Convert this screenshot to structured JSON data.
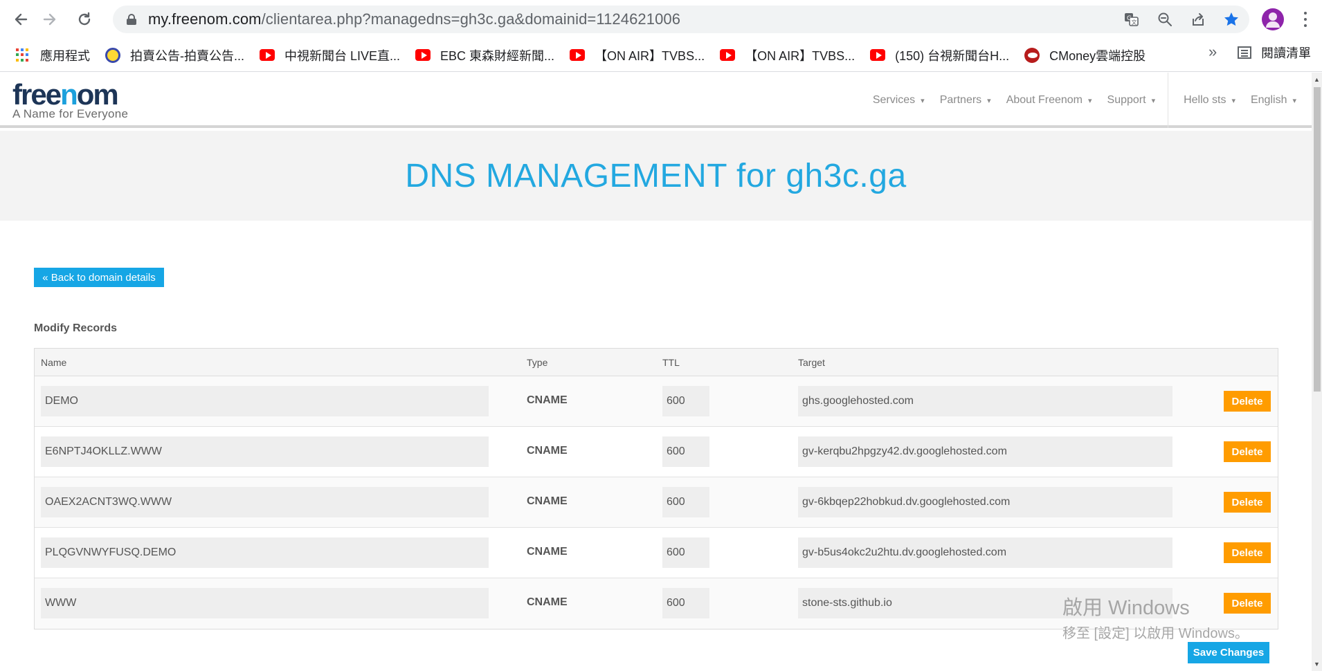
{
  "browser": {
    "url_host": "my.freenom.com",
    "url_rest": "/clientarea.php?managedns=gh3c.ga&domainid=1124621006",
    "bookmarks": [
      {
        "label": "應用程式",
        "icon": "apps-grid-icon"
      },
      {
        "label": "拍賣公告-拍賣公告...",
        "icon": "auction-icon"
      },
      {
        "label": "中視新聞台 LIVE直...",
        "icon": "youtube-icon"
      },
      {
        "label": "EBC 東森財經新聞...",
        "icon": "youtube-icon"
      },
      {
        "label": "【ON AIR】TVBS...",
        "icon": "youtube-icon"
      },
      {
        "label": "【ON AIR】TVBS...",
        "icon": "youtube-icon"
      },
      {
        "label": "(150) 台視新聞台H...",
        "icon": "youtube-icon"
      },
      {
        "label": "CMoney雲端控股",
        "icon": "cmoney-icon"
      }
    ],
    "overflow_label": "»",
    "reading_list_label": "閱讀清單"
  },
  "site": {
    "logo_dark_1": "free",
    "logo_blue": "n",
    "logo_dark_2": "om",
    "tagline": "A Name for Everyone",
    "nav": [
      "Services",
      "Partners",
      "About Freenom",
      "Support"
    ],
    "user_menu": "Hello sts",
    "language": "English"
  },
  "page": {
    "title": "DNS MANAGEMENT for gh3c.ga",
    "back_button": "« Back to domain details",
    "section_heading": "Modify Records",
    "columns": {
      "name": "Name",
      "type": "Type",
      "ttl": "TTL",
      "target": "Target"
    },
    "records": [
      {
        "name": "DEMO",
        "type": "CNAME",
        "ttl": "600",
        "target": "ghs.googlehosted.com",
        "action": "Delete"
      },
      {
        "name": "E6NPTJ4OKLLZ.WWW",
        "type": "CNAME",
        "ttl": "600",
        "target": "gv-kerqbu2hpgzy42.dv.googlehosted.com",
        "action": "Delete"
      },
      {
        "name": "OAEX2ACNT3WQ.WWW",
        "type": "CNAME",
        "ttl": "600",
        "target": "gv-6kbqep22hobkud.dv.googlehosted.com",
        "action": "Delete"
      },
      {
        "name": "PLQGVNWYFUSQ.DEMO",
        "type": "CNAME",
        "ttl": "600",
        "target": "gv-b5us4okc2u2htu.dv.googlehosted.com",
        "action": "Delete"
      },
      {
        "name": "WWW",
        "type": "CNAME",
        "ttl": "600",
        "target": "stone-sts.github.io",
        "action": "Delete"
      }
    ],
    "save_button": "Save Changes"
  },
  "watermark": {
    "line1": "啟用 Windows",
    "line2": "移至 [設定] 以啟用 Windows。"
  },
  "colors": {
    "brand_blue": "#16a6e5",
    "title_blue": "#23a8e0",
    "delete_orange": "#ff9c00",
    "logo_dark": "#1d3557"
  }
}
